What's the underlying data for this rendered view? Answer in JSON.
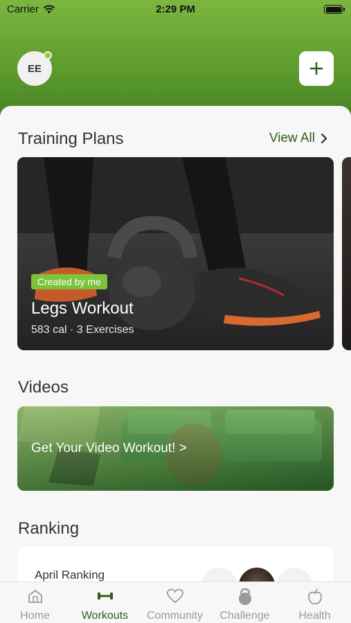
{
  "status_bar": {
    "carrier": "Carrier",
    "time": "2:29 PM"
  },
  "header": {
    "avatar_initials": "EE"
  },
  "training_plans": {
    "title": "Training Plans",
    "view_all": "View All",
    "card": {
      "badge": "Created by me",
      "title": "Legs Workout",
      "meta": "583 cal · 3 Exercises"
    }
  },
  "videos": {
    "title": "Videos",
    "card_text": "Get Your Video Workout! >"
  },
  "ranking": {
    "title": "Ranking",
    "card_label": "April Ranking"
  },
  "tabbar": {
    "items": [
      {
        "label": "Home",
        "icon": "home-icon"
      },
      {
        "label": "Workouts",
        "icon": "dumbbell-icon"
      },
      {
        "label": "Community",
        "icon": "heart-icon"
      },
      {
        "label": "Challenge",
        "icon": "kettlebell-icon"
      },
      {
        "label": "Health",
        "icon": "apple-icon"
      }
    ],
    "active_index": 1
  },
  "colors": {
    "accent": "#2f5d1c",
    "badge": "#7cc33a",
    "header_top": "#7bb63f",
    "header_bottom": "#3f7d23"
  }
}
